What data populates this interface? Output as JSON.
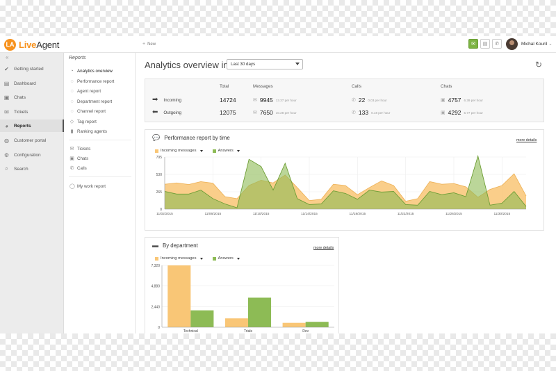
{
  "app": {
    "logo_mark": "LA",
    "logo_brand": "Live",
    "logo_brand2": "Agent"
  },
  "topbar": {
    "new_label": "New",
    "user_name": "Michal Kouril"
  },
  "nav": {
    "collapse_icon": "«",
    "items": [
      {
        "label": "Getting started",
        "icon": "check-icon",
        "glyph": "✔"
      },
      {
        "label": "Dashboard",
        "icon": "dashboard-icon",
        "glyph": "▤"
      },
      {
        "label": "Chats",
        "icon": "chat-icon",
        "glyph": "▣"
      },
      {
        "label": "Tickets",
        "icon": "envelope-icon",
        "glyph": "✉"
      },
      {
        "label": "Reports",
        "icon": "reports-icon",
        "glyph": "◕"
      },
      {
        "label": "Customer portal",
        "icon": "portal-icon",
        "glyph": "◍"
      },
      {
        "label": "Configuration",
        "icon": "gear-icon",
        "glyph": "⚙"
      },
      {
        "label": "Search",
        "icon": "search-icon",
        "glyph": "⌕"
      }
    ]
  },
  "subnav": {
    "title": "Reports",
    "items": [
      {
        "label": "Analytics overview",
        "glyph": "◔"
      },
      {
        "label": "Performance report",
        "glyph": "◌"
      },
      {
        "label": "Agent report",
        "glyph": "◌"
      },
      {
        "label": "Department report",
        "glyph": "◌"
      },
      {
        "label": "Channel report",
        "glyph": "◌"
      },
      {
        "label": "Tag report",
        "glyph": "◇"
      },
      {
        "label": "Ranking agents",
        "glyph": "▮"
      },
      {
        "label": "Tickets",
        "glyph": "✉"
      },
      {
        "label": "Chats",
        "glyph": "▣"
      },
      {
        "label": "Calls",
        "glyph": "✆"
      },
      {
        "label": "My work report",
        "glyph": "◯"
      }
    ]
  },
  "main": {
    "title": "Analytics overview in",
    "range": "Last 30 days",
    "summary": {
      "headers": {
        "total": "Total",
        "messages": "Messages",
        "calls": "Calls",
        "chats": "Chats"
      },
      "rows": [
        {
          "label": "Incoming",
          "total": "14724",
          "messages": "9945",
          "messages_rate": "13.37 per hour",
          "calls": "22",
          "calls_rate": "0.03 per hour",
          "chats": "4757",
          "chats_rate": "6.39 per hour"
        },
        {
          "label": "Outgoing",
          "total": "12075",
          "messages": "7650",
          "messages_rate": "10.28 per hour",
          "calls": "133",
          "calls_rate": "0.18 per hour",
          "chats": "4292",
          "chats_rate": "5.77 per hour"
        }
      ]
    },
    "perf_title": "Performance report by time",
    "dept_title": "By department",
    "more_details": "more details",
    "legend_incoming": "Incoming messages",
    "legend_answers": "Answers"
  },
  "colors": {
    "incoming": "#f9c676",
    "answers": "#8dbb55",
    "answers_line": "#6e9e36",
    "accent": "#f7921e"
  },
  "chart_data": [
    {
      "type": "area",
      "title": "Performance report by time",
      "ylim": [
        0,
        795
      ],
      "yticks": [
        0,
        265,
        530,
        795
      ],
      "yticklabels": [
        "0",
        "265",
        "530",
        "795"
      ],
      "x_tick_labels": [
        "11/02/2015",
        "11/06/2015",
        "11/10/2015",
        "11/14/2015",
        "11/18/2015",
        "11/22/2015",
        "11/26/2015",
        "11/30/2015"
      ],
      "x_tick_every": 4,
      "series": [
        {
          "name": "Incoming messages",
          "values": [
            380,
            400,
            375,
            420,
            395,
            190,
            160,
            360,
            440,
            400,
            520,
            330,
            130,
            150,
            380,
            360,
            220,
            330,
            430,
            360,
            120,
            160,
            420,
            380,
            390,
            340,
            180,
            300,
            360,
            540,
            200
          ]
        },
        {
          "name": "Answers",
          "values": [
            270,
            230,
            230,
            290,
            160,
            80,
            20,
            760,
            650,
            290,
            700,
            160,
            70,
            80,
            280,
            240,
            150,
            290,
            260,
            270,
            70,
            60,
            270,
            220,
            250,
            190,
            810,
            60,
            90,
            270,
            40
          ]
        }
      ]
    },
    {
      "type": "bar",
      "title": "By department",
      "categories": [
        "Technical",
        "Trials",
        "Dev"
      ],
      "ylim": [
        0,
        7320
      ],
      "yticks": [
        0,
        2440,
        4880,
        7320
      ],
      "yticklabels": [
        "0",
        "2,440",
        "4,880",
        "7,320"
      ],
      "series": [
        {
          "name": "Incoming messages",
          "values": [
            7320,
            1050,
            520
          ]
        },
        {
          "name": "Answers",
          "values": [
            2000,
            3500,
            640
          ]
        }
      ]
    }
  ]
}
